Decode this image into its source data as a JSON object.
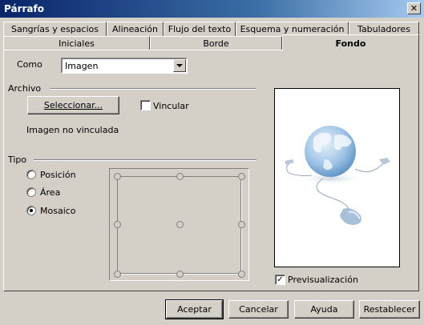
{
  "window": {
    "title": "Párrafo",
    "close_icon": "close-icon"
  },
  "tabs_row1": [
    "Sangrías y espacios",
    "Alineación",
    "Flujo del texto",
    "Esquema y numeración",
    "Tabuladores"
  ],
  "tabs_row2": [
    "Iniciales",
    "Borde",
    "Fondo"
  ],
  "active_tab": "Fondo",
  "como": {
    "label": "Como",
    "value": "Imagen"
  },
  "archivo": {
    "section_label": "Archivo",
    "select_button": "Seleccionar...",
    "vincular_label": "Vincular",
    "vincular_checked": false,
    "status": "Imagen no vinculada"
  },
  "tipo": {
    "section_label": "Tipo",
    "options": [
      "Posición",
      "Área",
      "Mosaico"
    ],
    "selected": "Mosaico"
  },
  "preview": {
    "label": "Previsualización",
    "checked": true
  },
  "buttons": {
    "accept": "Aceptar",
    "cancel": "Cancelar",
    "help": "Ayuda",
    "reset": "Restablecer"
  },
  "colors": {
    "titlebar": "#0a246a",
    "dialog": "#d4d0c8"
  }
}
